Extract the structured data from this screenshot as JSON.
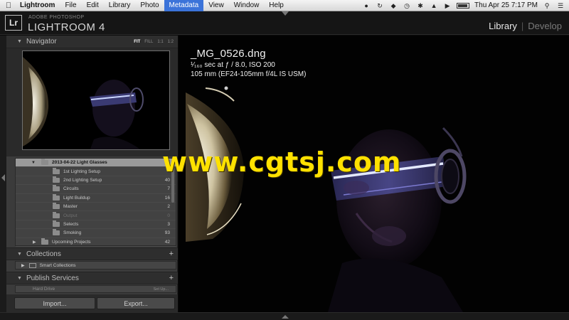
{
  "menubar": {
    "app": "Lightroom",
    "items": [
      "File",
      "Edit",
      "Library",
      "Photo",
      "Metadata",
      "View",
      "Window",
      "Help"
    ],
    "active_item": "Metadata",
    "clock": "Thu Apr 25  7:17 PM"
  },
  "header": {
    "brand_small": "ADOBE PHOTOSHOP",
    "brand_big": "LIGHTROOM 4",
    "badge": "Lr",
    "modules": [
      "Library",
      "Develop"
    ],
    "active_module": "Library",
    "separator": "|"
  },
  "navigator": {
    "title": "Navigator",
    "zoom_options": [
      "FIT",
      "FILL",
      "1:1",
      "1:2"
    ],
    "active_zoom": "FIT"
  },
  "folders": {
    "rows": [
      {
        "name": "2013-04-22 Light Glasses",
        "count": "14",
        "level": 0,
        "selected": true,
        "dim": false
      },
      {
        "name": "1st Lighting Setup",
        "count": "",
        "level": 1,
        "selected": false,
        "dim": false
      },
      {
        "name": "2nd Lighting Setup",
        "count": "40",
        "level": 1,
        "selected": false,
        "dim": false
      },
      {
        "name": "Circuits",
        "count": "7",
        "level": 1,
        "selected": false,
        "dim": false
      },
      {
        "name": "Light Buildup",
        "count": "16",
        "level": 1,
        "selected": false,
        "dim": false
      },
      {
        "name": "Master",
        "count": "2",
        "level": 1,
        "selected": false,
        "dim": false
      },
      {
        "name": "Output",
        "count": "0",
        "level": 1,
        "selected": false,
        "dim": true
      },
      {
        "name": "Selects",
        "count": "3",
        "level": 1,
        "selected": false,
        "dim": false
      },
      {
        "name": "Smoking",
        "count": "93",
        "level": 1,
        "selected": false,
        "dim": false
      },
      {
        "name": "Upcoming Projects",
        "count": "42",
        "level": 0,
        "selected": false,
        "dim": false
      }
    ]
  },
  "collections": {
    "title": "Collections",
    "smart_collections": "Smart Collections"
  },
  "publish": {
    "title": "Publish Services",
    "hard_drive": "Hard Drive",
    "setup": "Set Up..."
  },
  "buttons": {
    "import": "Import...",
    "export": "Export..."
  },
  "photo_info": {
    "filename": "_MG_0526.dng",
    "exposure": "¹⁄₁₆₀ sec at ƒ / 8.0, ISO 200",
    "lens": "105 mm (EF24-105mm f/4L IS USM)"
  },
  "watermark": "www.cgtsj.com"
}
